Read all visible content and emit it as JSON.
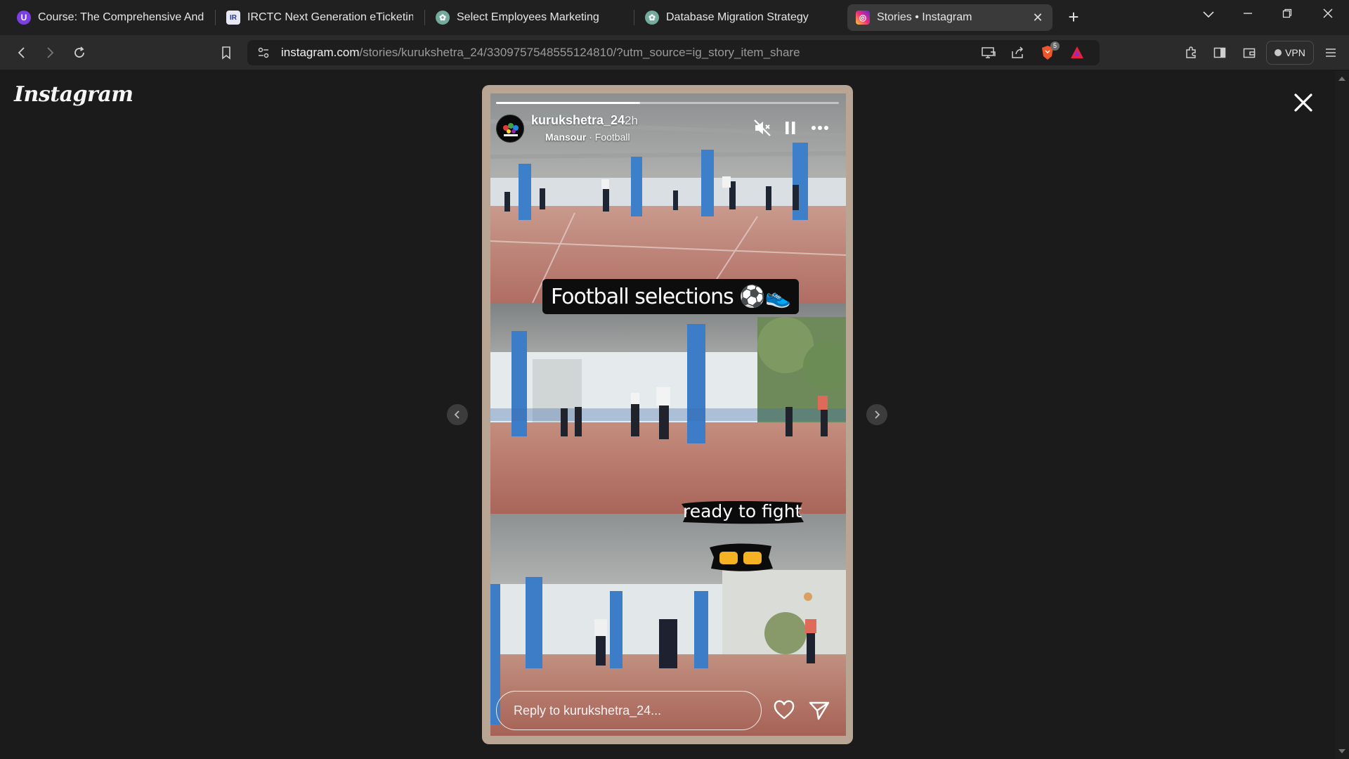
{
  "browser": {
    "tabs": [
      {
        "title": "Course: The Comprehensive Android",
        "icon": "course-icon"
      },
      {
        "title": "IRCTC Next Generation eTicketing Sy",
        "icon": "irctc-icon"
      },
      {
        "title": "Select Employees Marketing",
        "icon": "chatgpt-icon"
      },
      {
        "title": "Database Migration Strategy",
        "icon": "chatgpt-icon"
      },
      {
        "title": "Stories • Instagram",
        "icon": "instagram-icon",
        "active": true
      }
    ],
    "url": {
      "host": "instagram.com",
      "path": "/stories/kurukshetra_24/3309757548555124810/?utm_source=ig_story_item_share"
    },
    "vpn_label": "VPN",
    "shields_badge": "5"
  },
  "page": {
    "logo": "Instagram",
    "story": {
      "username": "kurukshetra_24",
      "time": "2h",
      "audio_artist": "Mansour",
      "audio_title": "Football",
      "audio_separator": " · ",
      "progress": 0.42,
      "caption": "Football selections ⚽👟",
      "sticker": "ready to fight",
      "reply_placeholder": "Reply to kurukshetra_24..."
    }
  },
  "colors": {
    "accent_instagram": "#e1306c",
    "page_bg": "#1b1b1b",
    "story_frame": "#b9a593"
  }
}
